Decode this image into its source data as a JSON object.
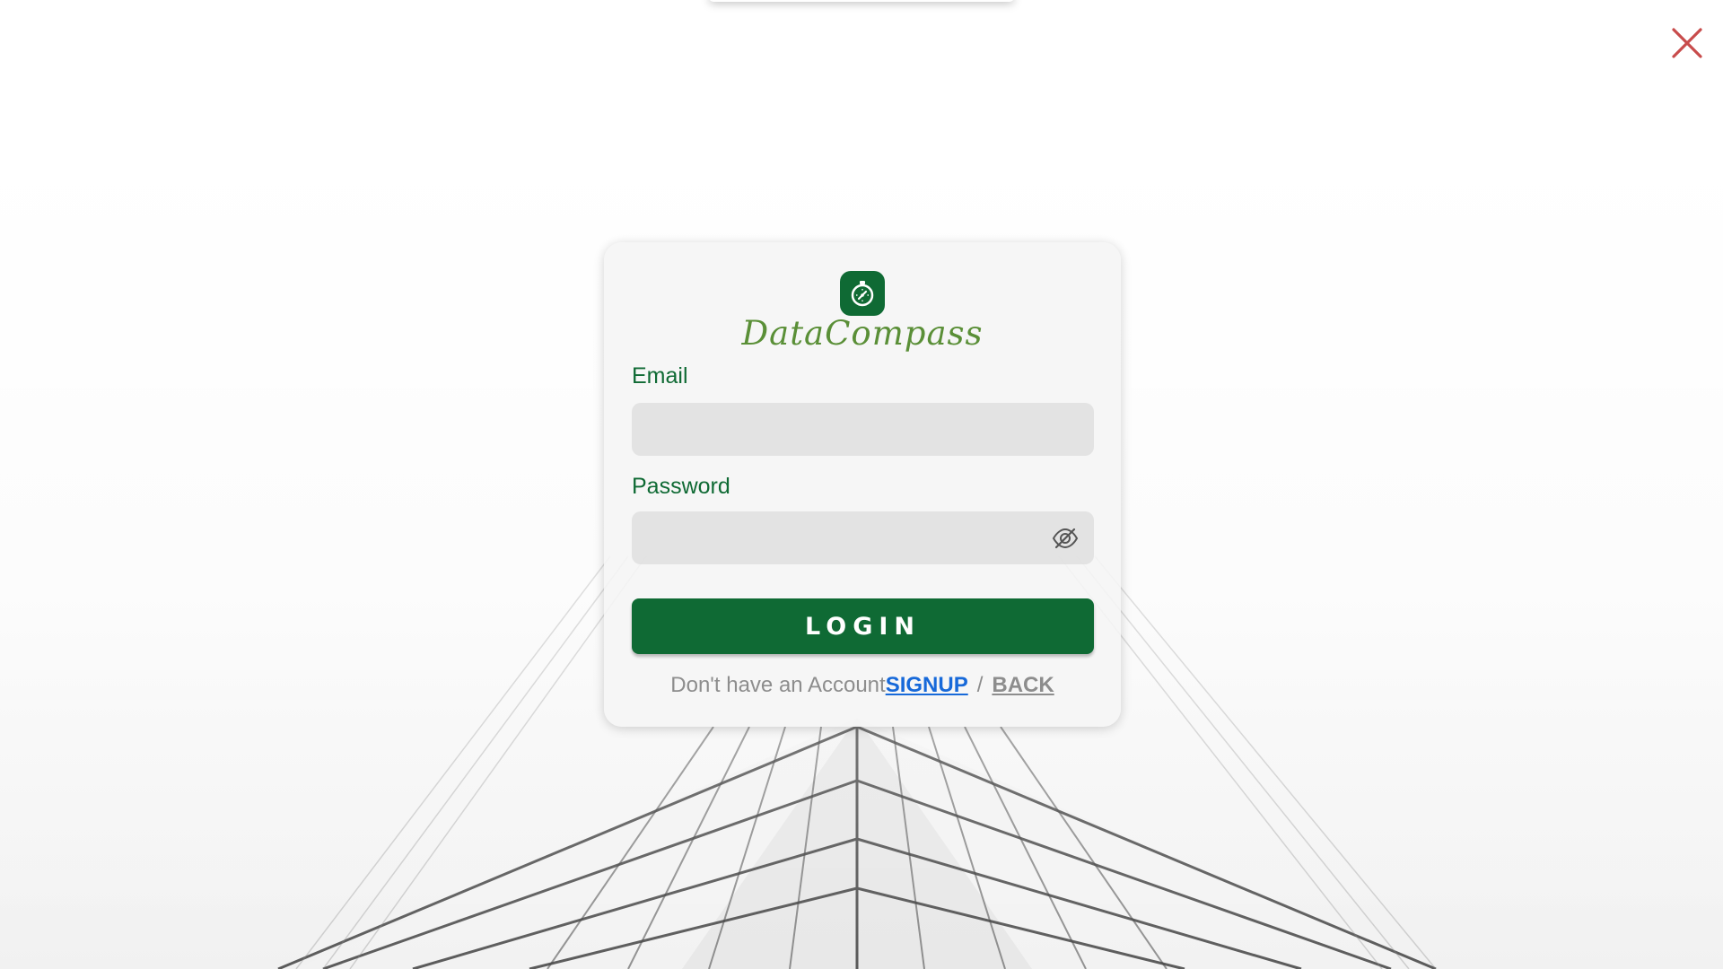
{
  "app": {
    "brand_name": "DataCompass"
  },
  "form": {
    "email_label": "Email",
    "email_value": "",
    "email_placeholder": "",
    "password_label": "Password",
    "password_value": "",
    "password_placeholder": "",
    "login_label": "LOGIN"
  },
  "footer": {
    "prompt": "Don't have an Account",
    "signup_label": "SIGNUP",
    "separator": "/",
    "back_label": "BACK"
  },
  "icons": {
    "logo": "compass-icon",
    "visibility": "eye-slash-icon",
    "close": "close-icon"
  },
  "colors": {
    "brand_green": "#0f6a34",
    "brand_text": "#5a8f37",
    "signup_blue": "#1769d9",
    "close_red": "#c84b4b"
  }
}
